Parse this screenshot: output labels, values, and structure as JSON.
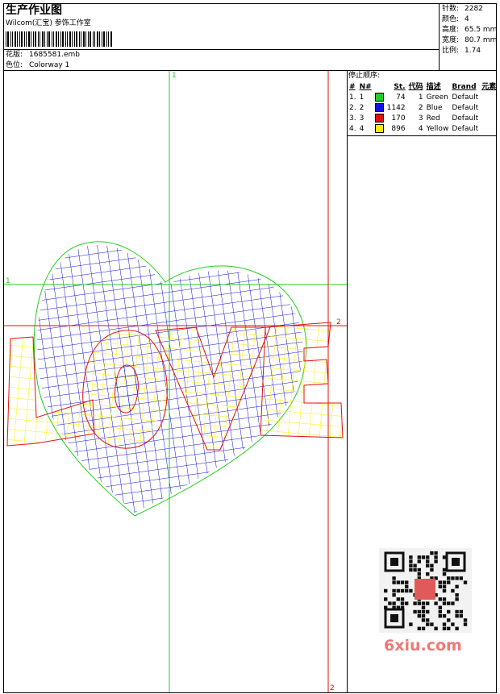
{
  "header": {
    "title": "生产作业图",
    "company": "Wilcom(汇宝) 参饰工作室",
    "design_label": "花版:",
    "design_value": "1685581.emb",
    "colorway_label": "色位:",
    "colorway_value": "Colorway 1"
  },
  "stats": {
    "stitches_label": "针数:",
    "stitches_value": "2282",
    "colors_label": "颜色:",
    "colors_value": "4",
    "height_label": "高度:",
    "height_value": "65.5 mm",
    "width_label": "宽度:",
    "width_value": "80.7 mm",
    "ratio_label": "比例:",
    "ratio_value": "1.74"
  },
  "stop_sequence": {
    "heading": "停止顺序:",
    "columns": [
      "#",
      "N#",
      "St.",
      "代码",
      "描述",
      "Brand",
      "元素"
    ],
    "rows": [
      {
        "idx": "1.",
        "n": "1",
        "color": "#22cc22",
        "st": "74",
        "code": "1",
        "desc": "Green",
        "brand": "Default"
      },
      {
        "idx": "2.",
        "n": "2",
        "color": "#1010e0",
        "st": "1142",
        "code": "2",
        "desc": "Blue",
        "brand": "Default"
      },
      {
        "idx": "3.",
        "n": "3",
        "color": "#e01010",
        "st": "170",
        "code": "3",
        "desc": "Red",
        "brand": "Default"
      },
      {
        "idx": "4.",
        "n": "4",
        "color": "#ffee00",
        "st": "896",
        "code": "4",
        "desc": "Yellow",
        "brand": "Default"
      }
    ]
  },
  "guides": {
    "v1_label": "1",
    "h1_label": "1",
    "h2_label": "2",
    "v2_label": "2"
  },
  "watermark": {
    "site": "6xiu.com"
  },
  "colors": {
    "green": "#22cc22",
    "blue": "#1010e0",
    "red": "#e01010",
    "yellow": "#ffee00"
  }
}
